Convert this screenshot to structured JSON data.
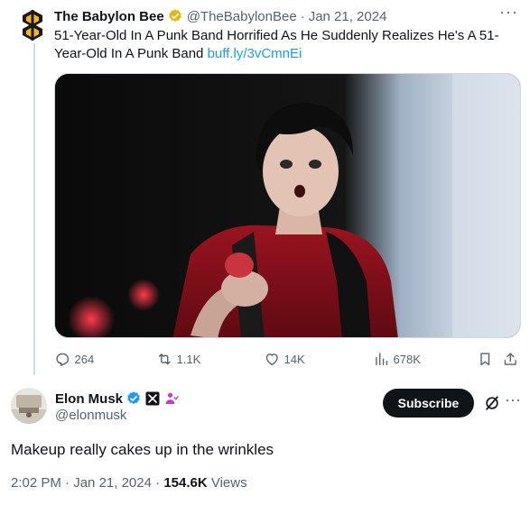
{
  "parent_tweet": {
    "author_name": "The Babylon Bee",
    "handle": "@TheBabylonBee",
    "date": "Jan 21, 2024",
    "separator": "·",
    "more": "···",
    "text": "51-Year-Old In A Punk Band Horrified As He Suddenly Realizes He's A 51-Year-Old In A Punk Band",
    "link": "buff.ly/3vCmnEi",
    "stats": {
      "replies": "264",
      "reposts": "1.1K",
      "likes": "14K",
      "views": "678K"
    }
  },
  "main_tweet": {
    "author_name": "Elon Musk",
    "handle": "@elonmusk",
    "subscribe_label": "Subscribe",
    "more": "···",
    "text": "Makeup really cakes up in the wrinkles",
    "time": "2:02 PM",
    "date": "Jan 21, 2024",
    "separator": "·",
    "views_count": "154.6K",
    "views_label": "Views"
  },
  "colors": {
    "accent_link": "#1d9bf0",
    "muted_text": "#536471",
    "verified_gold": "#e2b719",
    "verified_blue": "#1d9bf0",
    "subscribe_bg": "#0f1419"
  }
}
